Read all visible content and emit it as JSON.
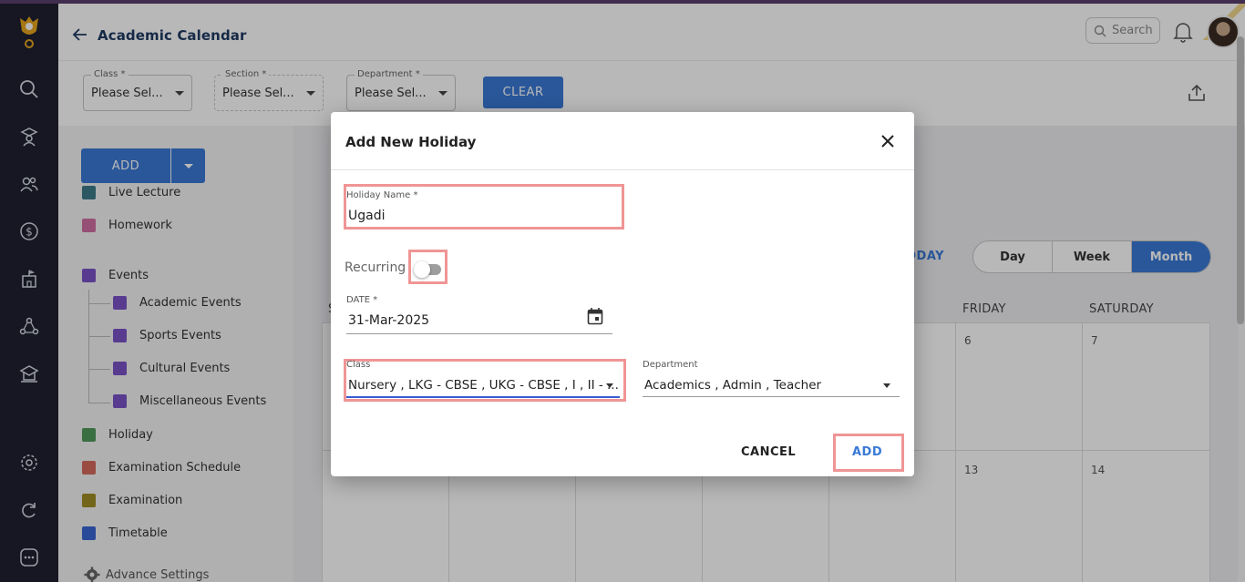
{
  "header": {
    "title": "Academic Calendar",
    "search_placeholder": "Search"
  },
  "filters": {
    "class": {
      "label": "Class *",
      "value": "Please Sel..."
    },
    "section": {
      "label": "Section *",
      "value": "Please Sel..."
    },
    "department": {
      "label": "Department *",
      "value": "Please Sel..."
    },
    "clear_label": "CLEAR"
  },
  "sidebar": {
    "add_label": "ADD",
    "legend": [
      {
        "label": "Live Lecture",
        "color": "#3e7a8a"
      },
      {
        "label": "Homework",
        "color": "#d26fa2"
      },
      {
        "label": "Events",
        "color": "#7a52c7"
      },
      {
        "label": "Academic Events",
        "color": "#7a52c7"
      },
      {
        "label": "Sports Events",
        "color": "#7a52c7"
      },
      {
        "label": "Cultural Events",
        "color": "#7a52c7"
      },
      {
        "label": "Miscellaneous Events",
        "color": "#7a52c7"
      },
      {
        "label": "Holiday",
        "color": "#4f9a5a"
      },
      {
        "label": "Examination Schedule",
        "color": "#d66a5c"
      },
      {
        "label": "Examination",
        "color": "#a08d25"
      },
      {
        "label": "Timetable",
        "color": "#3a66d4"
      }
    ],
    "advance_settings": "Advance Settings"
  },
  "calendar": {
    "today_label": "TODAY",
    "today_partial": "ODAY",
    "views": [
      "Day",
      "Week",
      "Month"
    ],
    "active_view": "Month",
    "visible_day_headers": [
      "S",
      "FRIDAY",
      "SATURDAY"
    ],
    "visible_dates": [
      "6",
      "7",
      "13",
      "14"
    ]
  },
  "modal": {
    "title": "Add New Holiday",
    "holiday_name_label": "Holiday Name *",
    "holiday_name_value": "Ugadi",
    "recurring_label": "Recurring",
    "recurring_on": false,
    "date_label": "DATE *",
    "date_value": "31-Mar-2025",
    "class_label": "Class",
    "class_value": "Nursery , LKG - CBSE , UKG - CBSE , I , II - ...",
    "department_label": "Department",
    "department_value": "Academics , Admin , Teacher",
    "cancel_label": "CANCEL",
    "add_label": "ADD"
  }
}
